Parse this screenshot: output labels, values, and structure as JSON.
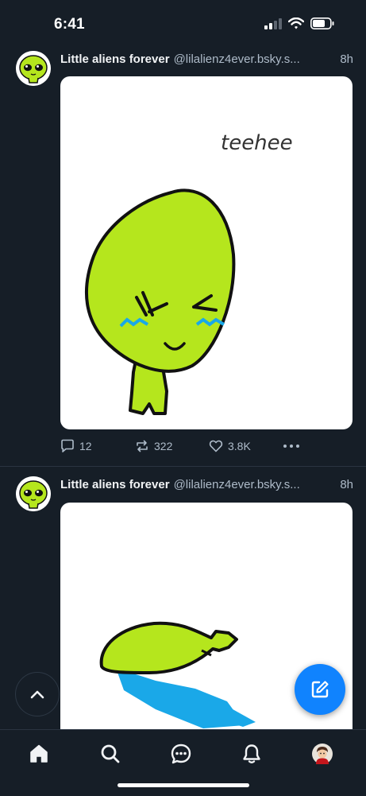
{
  "status_bar": {
    "time": "6:41"
  },
  "feed": {
    "posts": [
      {
        "author_name": "Little aliens forever",
        "handle": "@lilalienz4ever.bsky.s...",
        "timestamp": "8h",
        "image_text": "teehee",
        "replies": "12",
        "reposts": "322",
        "likes": "3.8K"
      },
      {
        "author_name": "Little aliens forever",
        "handle": "@lilalienz4ever.bsky.s...",
        "timestamp": "8h"
      }
    ]
  },
  "icons": {
    "reply": "speech-bubble-icon",
    "repost": "repost-arrows-icon",
    "like": "heart-icon",
    "more": "ellipsis-icon",
    "scroll_top": "chevron-up-icon",
    "compose": "pencil-square-icon",
    "nav": [
      "home-icon",
      "search-icon",
      "chat-icon",
      "bell-icon",
      "user-avatar"
    ]
  },
  "colors": {
    "background": "#161e27",
    "accent": "#1083fe",
    "alien_green": "#b5e61d",
    "muted_text": "#aebbc9"
  }
}
